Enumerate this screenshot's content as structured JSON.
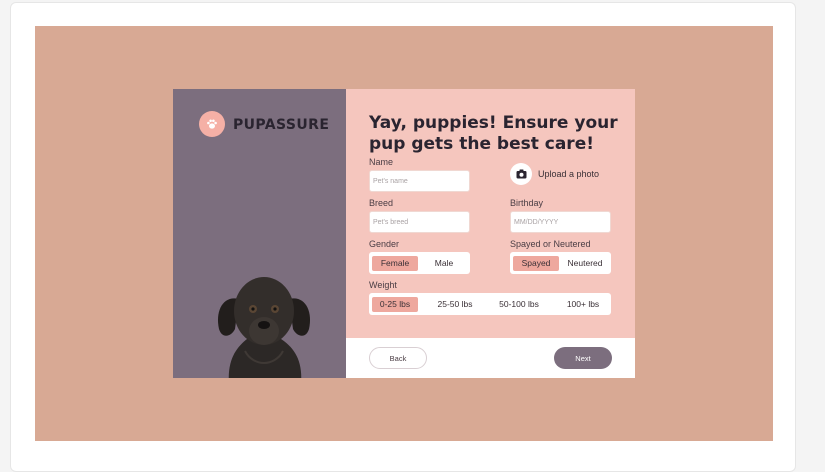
{
  "brand": {
    "name": "PUPASSURE",
    "icon": "paw-icon"
  },
  "form": {
    "title": "Yay, puppies! Ensure your pup gets the best care!",
    "name": {
      "label": "Name",
      "placeholder": "Pet's name"
    },
    "upload": {
      "label": "Upload a photo",
      "icon": "camera-icon"
    },
    "breed": {
      "label": "Breed",
      "placeholder": "Pet's breed"
    },
    "birthday": {
      "label": "Birthday",
      "placeholder": "MM/DD/YYYY"
    },
    "gender": {
      "label": "Gender",
      "options": [
        "Female",
        "Male"
      ],
      "selected": "Female"
    },
    "spayed": {
      "label": "Spayed or Neutered",
      "options": [
        "Spayed",
        "Neutered"
      ],
      "selected": "Spayed"
    },
    "weight": {
      "label": "Weight",
      "options": [
        "0-25 lbs",
        "25-50 lbs",
        "50-100 lbs",
        "100+ lbs"
      ],
      "selected": "0-25 lbs"
    }
  },
  "footer": {
    "back_label": "Back",
    "next_label": "Next"
  },
  "colors": {
    "background": "#d8a994",
    "sidebar": "#7c6e7e",
    "form_panel": "#f5c6be",
    "accent": "#eea89e",
    "primary_button": "#7c6e7e"
  }
}
